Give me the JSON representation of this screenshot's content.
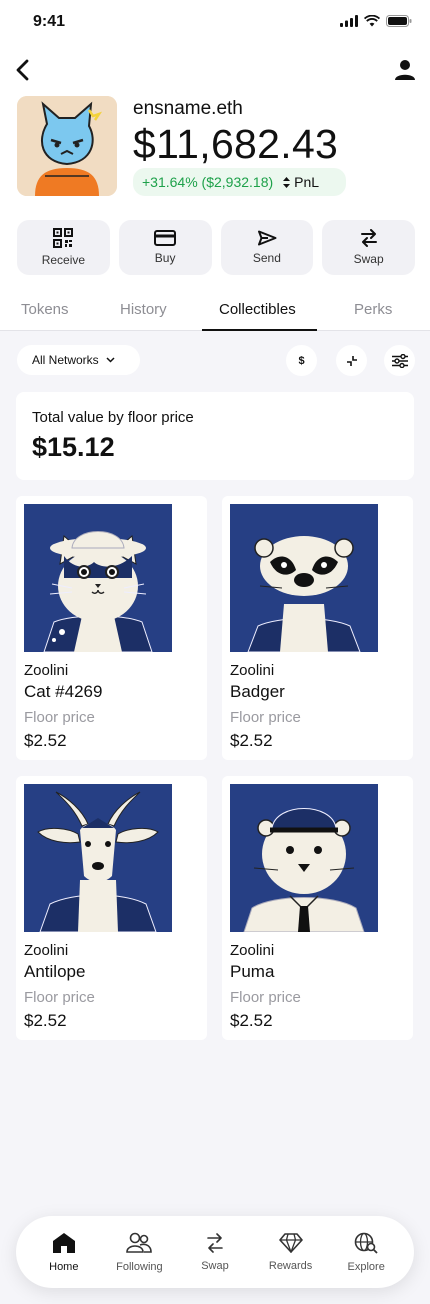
{
  "status": {
    "time": "9:41"
  },
  "header": {
    "back_icon": "chevron-left-icon",
    "profile_icon": "user-icon"
  },
  "wallet": {
    "name": "ensname.eth",
    "balance": "$11,682.43",
    "pnl_change": "+31.64% ($2,932.18)",
    "pnl_label": "PnL",
    "pnl_color": "#1ea14a"
  },
  "actions": [
    {
      "label": "Receive",
      "icon": "qr-code-icon"
    },
    {
      "label": "Buy",
      "icon": "credit-card-icon"
    },
    {
      "label": "Send",
      "icon": "send-icon"
    },
    {
      "label": "Swap",
      "icon": "swap-icon"
    }
  ],
  "tabs": [
    {
      "label": "Tokens"
    },
    {
      "label": "History"
    },
    {
      "label": "Collectibles",
      "active": true
    },
    {
      "label": "Perks"
    }
  ],
  "filters": {
    "network": "All Networks",
    "currency": "$"
  },
  "summary": {
    "label": "Total value by floor price",
    "value": "$15.12"
  },
  "collectibles": [
    {
      "collection": "Zoolini",
      "name": "Cat #4269",
      "floor_label": "Floor price",
      "floor_price": "$2.52"
    },
    {
      "collection": "Zoolini",
      "name": "Badger",
      "floor_label": "Floor price",
      "floor_price": "$2.52"
    },
    {
      "collection": "Zoolini",
      "name": "Antilope",
      "floor_label": "Floor price",
      "floor_price": "$2.52"
    },
    {
      "collection": "Zoolini",
      "name": "Puma",
      "floor_label": "Floor price",
      "floor_price": "$2.52"
    }
  ],
  "nav": [
    {
      "label": "Home",
      "icon": "home-icon",
      "active": true
    },
    {
      "label": "Following",
      "icon": "users-icon"
    },
    {
      "label": "Swap",
      "icon": "swap-icon"
    },
    {
      "label": "Rewards",
      "icon": "diamond-icon"
    },
    {
      "label": "Explore",
      "icon": "globe-search-icon"
    }
  ]
}
